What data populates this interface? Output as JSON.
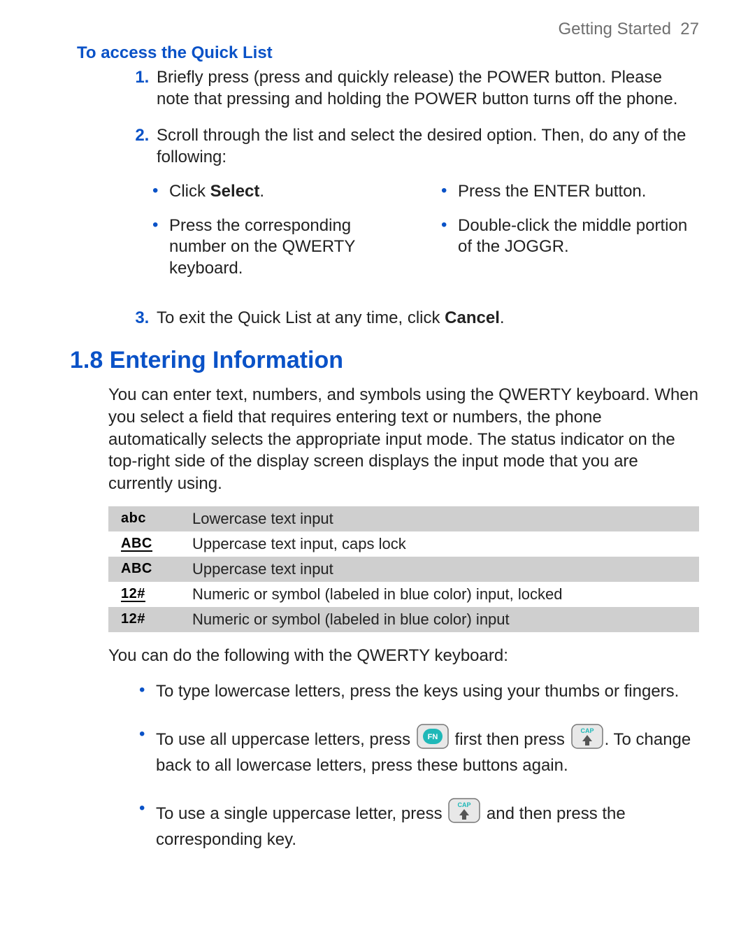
{
  "header": {
    "chapter": "Getting Started",
    "page_number": "27"
  },
  "quicklist": {
    "heading": "To access the Quick List",
    "step1": "Briefly press (press and quickly release) the POWER button. Please note that pressing and holding the POWER button turns off the phone.",
    "step2_intro": "Scroll through the list and select the desired option. Then, do any of the following:",
    "options": {
      "a_pre": "Click ",
      "a_bold": "Select",
      "a_post": ".",
      "b": "Press the ENTER button.",
      "c": "Press the corresponding number on the QWERTY keyboard.",
      "d": "Double-click the middle portion of the JOGGR."
    },
    "step3_pre": "To exit the Quick List at any time, click ",
    "step3_bold": "Cancel",
    "step3_post": "."
  },
  "section": {
    "number": "1.8",
    "title": "Entering Information",
    "intro": "You can enter text, numbers, and symbols using the QWERTY keyboard. When you select a field that requires entering text or numbers, the phone automatically selects the appropriate input mode. The status indicator on the top-right side of the display screen displays the input mode that you are currently using.",
    "table": [
      {
        "icon": "abc",
        "desc": "Lowercase text input"
      },
      {
        "icon": "ABC",
        "desc": "Uppercase text input, caps lock"
      },
      {
        "icon": "ABC",
        "desc": "Uppercase text input"
      },
      {
        "icon": "12#",
        "desc": "Numeric or symbol (labeled in blue color) input, locked"
      },
      {
        "icon": "12#",
        "desc": "Numeric or symbol (labeled in blue color) input"
      }
    ],
    "after_table": "You can do the following with the QWERTY keyboard:",
    "bullets": {
      "i1": "To type lowercase letters, press the keys using your thumbs or fingers.",
      "i2a": "To use all uppercase letters, press ",
      "i2b": " first then press ",
      "i2c": ". To change back to all lowercase letters, press these buttons again.",
      "i3a": "To use a single uppercase letter, press ",
      "i3b": " and then press the corresponding key."
    },
    "keys": {
      "fn_label": "FN",
      "cap_label": "CAP"
    }
  }
}
